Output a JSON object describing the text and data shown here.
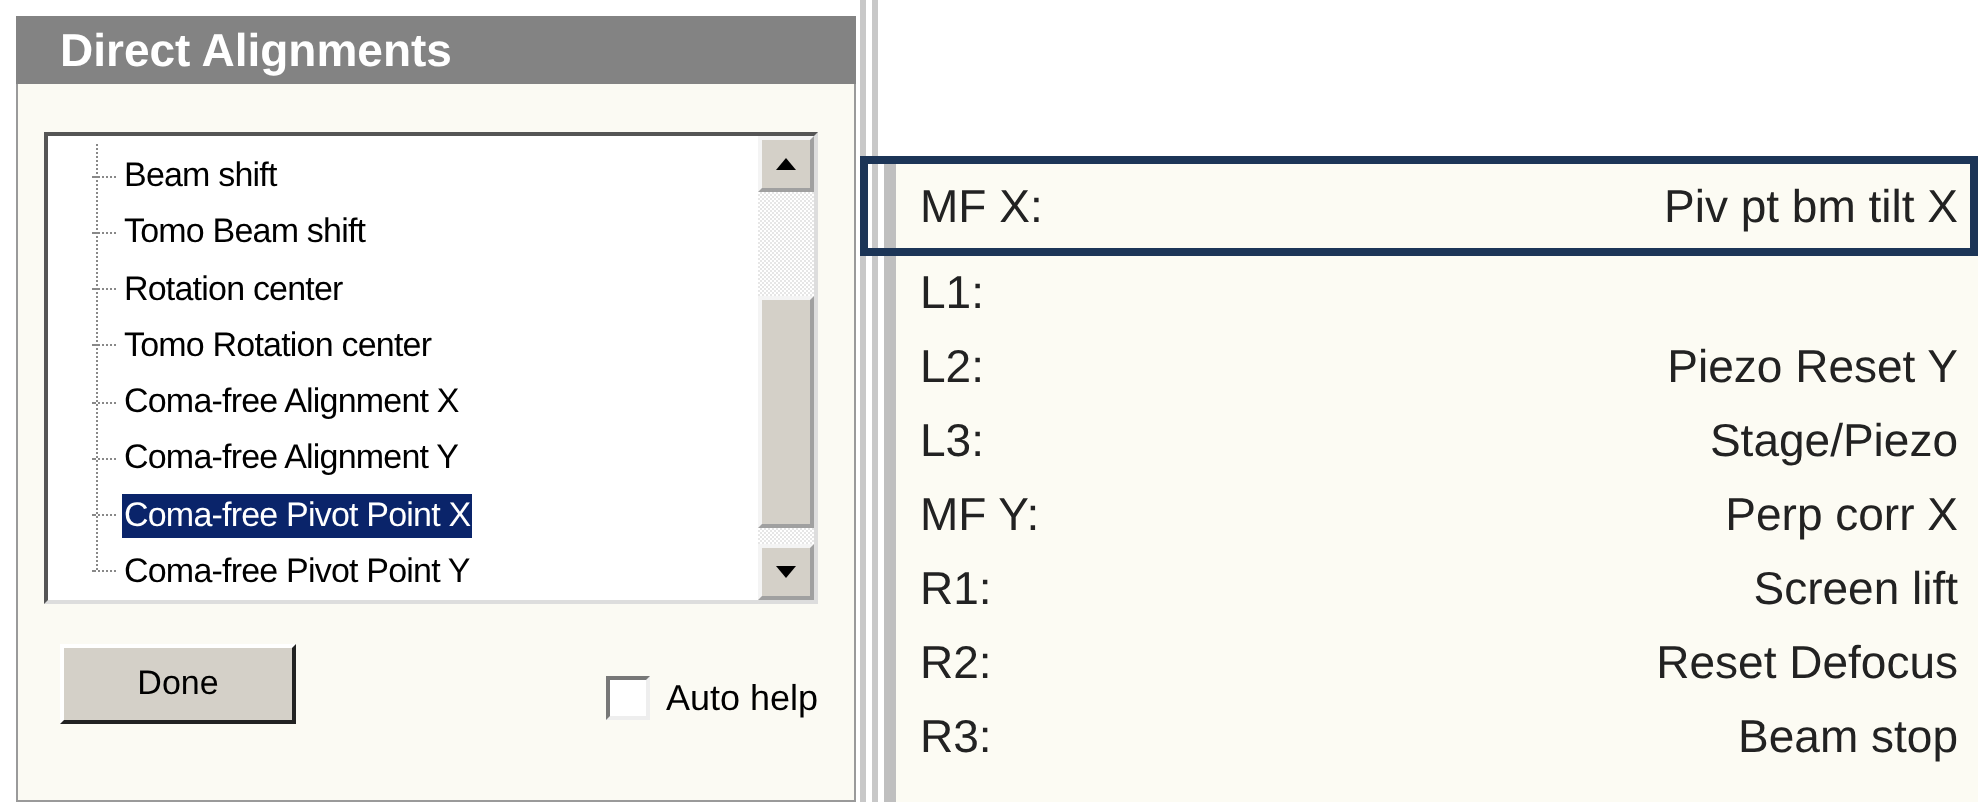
{
  "dialog": {
    "title": "Direct Alignments",
    "tree_items": [
      {
        "label": "Beam shift",
        "selected": false
      },
      {
        "label": "Tomo Beam shift",
        "selected": false
      },
      {
        "label": "Rotation center",
        "selected": false
      },
      {
        "label": "Tomo Rotation center",
        "selected": false
      },
      {
        "label": "Coma-free Alignment X",
        "selected": false
      },
      {
        "label": "Coma-free Alignment Y",
        "selected": false
      },
      {
        "label": "Coma-free Pivot Point X",
        "selected": true
      },
      {
        "label": "Coma-free Pivot Point Y",
        "selected": false
      }
    ],
    "done_button": "Done",
    "auto_help": {
      "label": "Auto help",
      "checked": false
    }
  },
  "assignments": [
    {
      "key": "MF X:",
      "function": "Piv pt bm tilt X",
      "highlighted": true
    },
    {
      "key": "L1:",
      "highlighted": false
    },
    {
      "key": "L2:",
      "function": "Piezo Reset Y",
      "highlighted": false
    },
    {
      "key": "L3:",
      "function": "Stage/Piezo",
      "highlighted": false
    },
    {
      "key": "MF Y:",
      "function": "Perp corr X",
      "highlighted": false
    },
    {
      "key": "R1:",
      "function": "Screen lift",
      "highlighted": false
    },
    {
      "key": "R2:",
      "function": "Reset Defocus",
      "highlighted": false
    },
    {
      "key": "R3:",
      "function": "Beam stop",
      "highlighted": false
    }
  ]
}
